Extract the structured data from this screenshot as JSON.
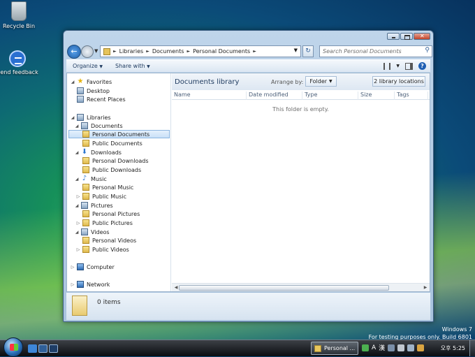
{
  "desktop": {
    "icons": [
      {
        "label": "Recycle Bin",
        "icon": "recycle-bin-icon"
      },
      {
        "label": "Send feedback",
        "icon": "feedback-icon"
      }
    ],
    "watermark": {
      "line1": "Windows 7",
      "line2": "For testing purposes only. Build 6801"
    }
  },
  "window": {
    "address": {
      "crumbs": [
        "Libraries",
        "Documents",
        "Personal Documents"
      ]
    },
    "search": {
      "placeholder": "Search Personal Documents"
    },
    "toolbar": {
      "organize": "Organize",
      "share_with": "Share with"
    },
    "nav_tree": {
      "favorites": "Favorites",
      "desktop": "Desktop",
      "recent_places": "Recent Places",
      "libraries": "Libraries",
      "documents": "Documents",
      "personal_documents": "Personal Documents",
      "public_documents": "Public Documents",
      "downloads": "Downloads",
      "personal_downloads": "Personal Downloads",
      "public_downloads": "Public Downloads",
      "music": "Music",
      "personal_music": "Personal Music",
      "public_music": "Public Music",
      "pictures": "Pictures",
      "personal_pictures": "Personal Pictures",
      "public_pictures": "Public Pictures",
      "videos": "Videos",
      "personal_videos": "Personal Videos",
      "public_videos": "Public Videos",
      "computer": "Computer",
      "network": "Network"
    },
    "library": {
      "title": "Documents library",
      "arrange_label": "Arrange by:",
      "arrange_value": "Folder",
      "locations_button": "2 library locations"
    },
    "columns": [
      "Name",
      "Date modified",
      "Type",
      "Size",
      "Tags"
    ],
    "empty_message": "This folder is empty.",
    "details": {
      "item_count": "0 items"
    }
  },
  "taskbar": {
    "task_label": "Personal ...",
    "ime": {
      "mode": "A",
      "hanja": "漢"
    },
    "clock": "오후 5:25"
  }
}
